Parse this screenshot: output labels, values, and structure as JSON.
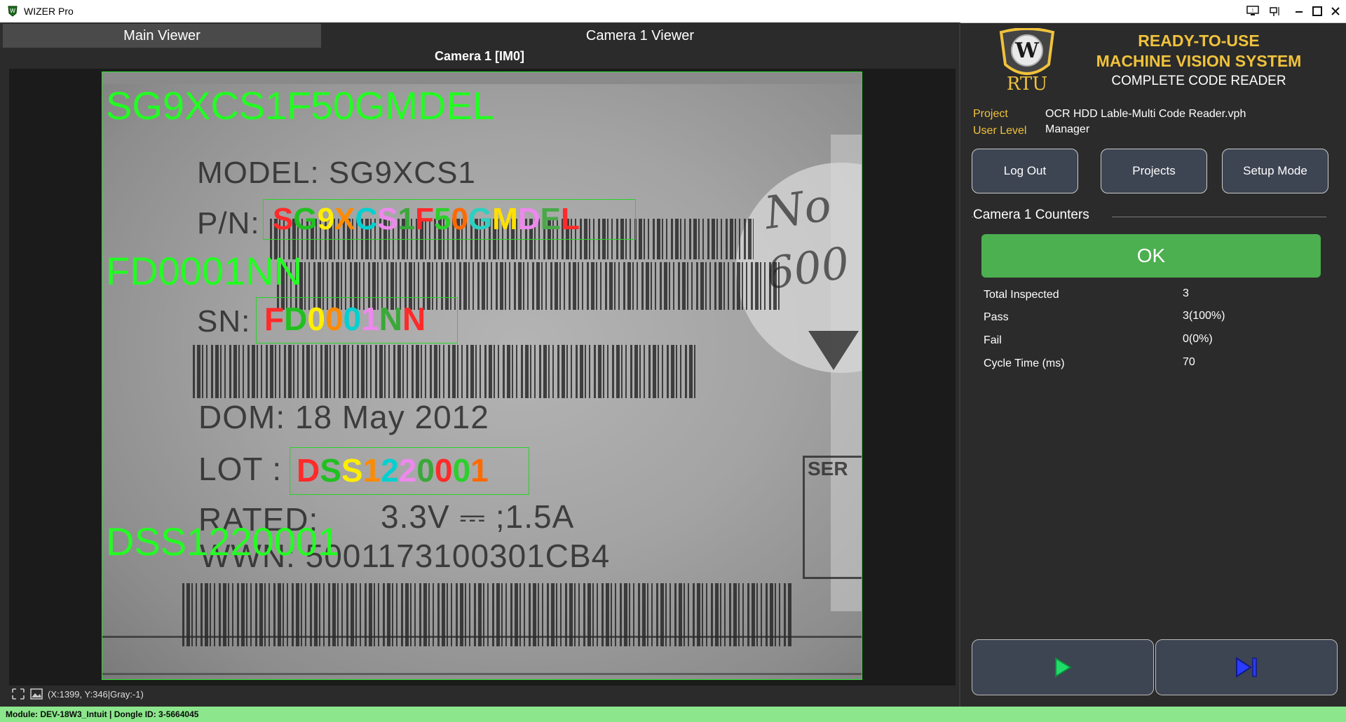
{
  "window": {
    "title": "WIZER Pro",
    "controls": [
      "monitor-icon",
      "pin-icon",
      "minimize-icon",
      "maximize-icon",
      "close-icon"
    ]
  },
  "tabs": [
    {
      "label": "Main Viewer",
      "active": true
    },
    {
      "label": "Camera 1 Viewer",
      "active": false
    }
  ],
  "viewer": {
    "title": "Camera 1  [IM0]",
    "printed_label": {
      "model": "MODEL: SG9XCS1",
      "pn": "P/N:",
      "sn": "SN:",
      "dom": "DOM: 18 May 2012",
      "lot": "LOT :",
      "rated": "RATED:",
      "rating": "3.3V ⎓ ;1.5A",
      "wwn": "WWN: 5001173100301CB4",
      "handwriting_1": "No",
      "handwriting_2": "600",
      "ser": "SER"
    },
    "results": [
      {
        "text": "SG9XCS1F50GMDEL",
        "chars": [
          "S",
          "G",
          "9",
          "X",
          "C",
          "S",
          "1",
          "F",
          "5",
          "0",
          "G",
          "M",
          "D",
          "E",
          "L"
        ]
      },
      {
        "text": "FD0001NN",
        "chars": [
          "F",
          "D",
          "0",
          "0",
          "0",
          "1",
          "N",
          "N"
        ]
      },
      {
        "text": "DSS1220001",
        "chars": [
          "D",
          "S",
          "S",
          "1",
          "2",
          "2",
          "0",
          "0",
          "0",
          "1"
        ]
      }
    ],
    "char_colors": [
      "#ff2a2a",
      "#20c020",
      "#ffee00",
      "#ff8a00",
      "#00d0d0",
      "#ee88ee",
      "#3aa83a",
      "#ff2a2a",
      "#2bd02b",
      "#ff6a00",
      "#2bd0c0",
      "#ffe000",
      "#ee88ee",
      "#4aa84a",
      "#ff2a2a"
    ],
    "coord_readout": "(X:1399, Y:346|Gray:-1)"
  },
  "brand": {
    "logo_text": "RTU",
    "line1": "READY-TO-USE",
    "line2": "MACHINE VISION SYSTEM",
    "line3": "COMPLETE CODE READER"
  },
  "info": {
    "project_label": "Project",
    "project_value": "OCR HDD Lable-Multi Code Reader.vph",
    "user_label": "User Level",
    "user_value": "Manager"
  },
  "buttons": {
    "logout": "Log Out",
    "projects": "Projects",
    "setup": "Setup Mode"
  },
  "counters": {
    "title": "Camera 1 Counters",
    "status": "OK",
    "rows": [
      {
        "label": "Total Inspected",
        "value": "3"
      },
      {
        "label": "Pass",
        "value": "3(100%)"
      },
      {
        "label": "Fail",
        "value": "0(0%)"
      },
      {
        "label": "Cycle Time (ms)",
        "value": "70"
      }
    ]
  },
  "status_bar": "Module: DEV-18W3_Intuit | Dongle ID: 3-5664045",
  "colors": {
    "accent_green": "#22ff22",
    "ok_green": "#4caf50",
    "brand_gold": "#f0c23c",
    "status_bar": "#8ce68c",
    "play_icon": "#1fdc6a",
    "step_icon": "#2a3cff"
  }
}
